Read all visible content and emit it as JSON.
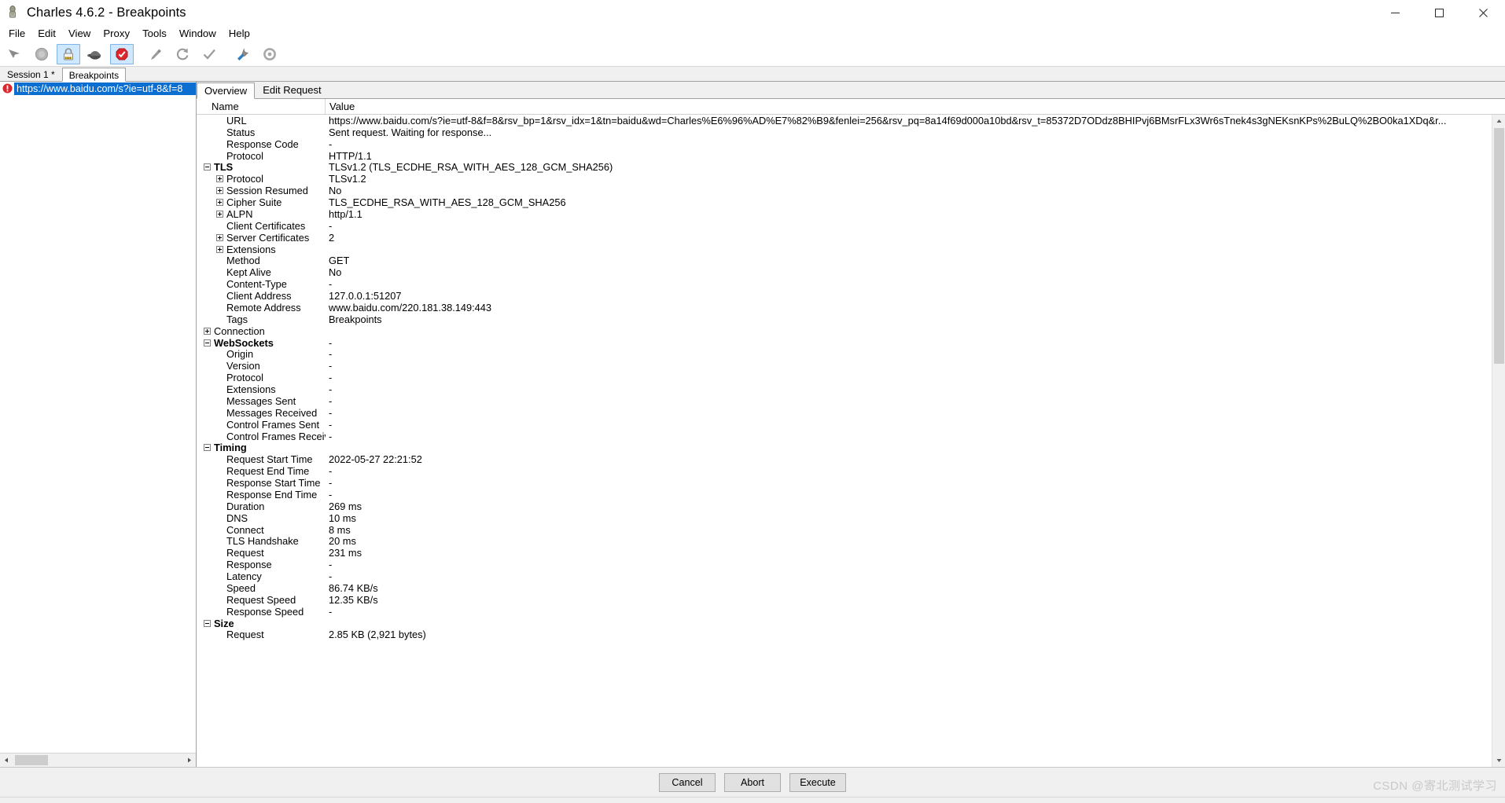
{
  "window": {
    "title": "Charles 4.6.2 - Breakpoints",
    "icon": "charles-app-icon",
    "minimize": "─",
    "maximize": "☐",
    "close": "✕"
  },
  "menubar": {
    "items": [
      "File",
      "Edit",
      "View",
      "Proxy",
      "Tools",
      "Window",
      "Help"
    ]
  },
  "toolbar": {
    "buttons": [
      {
        "name": "clear-session-icon",
        "glyph": "➤",
        "active": false
      },
      {
        "name": "record-icon",
        "glyph": "●",
        "active": false
      },
      {
        "name": "ssl-proxying-icon",
        "glyph": "🔒",
        "active": true
      },
      {
        "name": "throttling-icon",
        "glyph": "🐢",
        "active": true
      },
      {
        "name": "breakpoints-icon",
        "glyph": "⬣",
        "active": true
      },
      {
        "name": "compose-icon",
        "glyph": "✎",
        "active": false
      },
      {
        "name": "repeat-icon",
        "glyph": "↻",
        "active": false
      },
      {
        "name": "validate-icon",
        "glyph": "✓",
        "active": false
      },
      {
        "name": "tools-icon",
        "glyph": "⚒",
        "active": false
      },
      {
        "name": "settings-icon",
        "glyph": "⚙",
        "active": false
      }
    ]
  },
  "session_tabs": {
    "items": [
      {
        "label": "Session 1 *",
        "selected": false
      },
      {
        "label": "Breakpoints",
        "selected": true
      }
    ]
  },
  "request_list": {
    "items": [
      {
        "icon": "breakpoint-stop-icon",
        "url": "https://www.baidu.com/s?ie=utf-8&f=8",
        "selected": true
      }
    ]
  },
  "view_tabs": {
    "items": [
      {
        "label": "Overview",
        "selected": true
      },
      {
        "label": "Edit Request",
        "selected": false
      }
    ]
  },
  "table": {
    "headers": {
      "name": "Name",
      "value": "Value"
    },
    "rows": [
      {
        "indent": 1,
        "twisty": "none",
        "group": false,
        "name": "URL",
        "value": "https://www.baidu.com/s?ie=utf-8&f=8&rsv_bp=1&rsv_idx=1&tn=baidu&wd=Charles%E6%96%AD%E7%82%B9&fenlei=256&rsv_pq=8a14f69d000a10bd&rsv_t=85372D7ODdz8BHIPvj6BMsrFLx3Wr6sTnek4s3gNEKsnKPs%2BuLQ%2BO0ka1XDq&r..."
      },
      {
        "indent": 1,
        "twisty": "none",
        "group": false,
        "name": "Status",
        "value": "Sent request. Waiting for response..."
      },
      {
        "indent": 1,
        "twisty": "none",
        "group": false,
        "name": "Response Code",
        "value": "-"
      },
      {
        "indent": 1,
        "twisty": "none",
        "group": false,
        "name": "Protocol",
        "value": "HTTP/1.1"
      },
      {
        "indent": 0,
        "twisty": "minus",
        "group": true,
        "name": "TLS",
        "value": "TLSv1.2 (TLS_ECDHE_RSA_WITH_AES_128_GCM_SHA256)"
      },
      {
        "indent": 1,
        "twisty": "plus",
        "group": false,
        "name": "Protocol",
        "value": "TLSv1.2"
      },
      {
        "indent": 1,
        "twisty": "plus",
        "group": false,
        "name": "Session Resumed",
        "value": "No"
      },
      {
        "indent": 1,
        "twisty": "plus",
        "group": false,
        "name": "Cipher Suite",
        "value": "TLS_ECDHE_RSA_WITH_AES_128_GCM_SHA256"
      },
      {
        "indent": 1,
        "twisty": "plus",
        "group": false,
        "name": "ALPN",
        "value": "http/1.1"
      },
      {
        "indent": 1,
        "twisty": "none",
        "group": false,
        "name": "Client Certificates",
        "value": "-"
      },
      {
        "indent": 1,
        "twisty": "plus",
        "group": false,
        "name": "Server Certificates",
        "value": "2"
      },
      {
        "indent": 1,
        "twisty": "plus",
        "group": false,
        "name": "Extensions",
        "value": ""
      },
      {
        "indent": 1,
        "twisty": "none",
        "group": false,
        "name": "Method",
        "value": "GET"
      },
      {
        "indent": 1,
        "twisty": "none",
        "group": false,
        "name": "Kept Alive",
        "value": "No"
      },
      {
        "indent": 1,
        "twisty": "none",
        "group": false,
        "name": "Content-Type",
        "value": "-"
      },
      {
        "indent": 1,
        "twisty": "none",
        "group": false,
        "name": "Client Address",
        "value": "127.0.0.1:51207"
      },
      {
        "indent": 1,
        "twisty": "none",
        "group": false,
        "name": "Remote Address",
        "value": "www.baidu.com/220.181.38.149:443"
      },
      {
        "indent": 1,
        "twisty": "none",
        "group": false,
        "name": "Tags",
        "value": "Breakpoints"
      },
      {
        "indent": 0,
        "twisty": "plus",
        "group": false,
        "name": "Connection",
        "value": ""
      },
      {
        "indent": 0,
        "twisty": "minus",
        "group": true,
        "name": "WebSockets",
        "value": "-"
      },
      {
        "indent": 1,
        "twisty": "none",
        "group": false,
        "name": "Origin",
        "value": "-"
      },
      {
        "indent": 1,
        "twisty": "none",
        "group": false,
        "name": "Version",
        "value": "-"
      },
      {
        "indent": 1,
        "twisty": "none",
        "group": false,
        "name": "Protocol",
        "value": "-"
      },
      {
        "indent": 1,
        "twisty": "none",
        "group": false,
        "name": "Extensions",
        "value": "-"
      },
      {
        "indent": 1,
        "twisty": "none",
        "group": false,
        "name": "Messages Sent",
        "value": "-"
      },
      {
        "indent": 1,
        "twisty": "none",
        "group": false,
        "name": "Messages Received",
        "value": "-"
      },
      {
        "indent": 1,
        "twisty": "none",
        "group": false,
        "name": "Control Frames Sent",
        "value": "-"
      },
      {
        "indent": 1,
        "twisty": "none",
        "group": false,
        "name": "Control Frames Received",
        "value": "-"
      },
      {
        "indent": 0,
        "twisty": "minus",
        "group": true,
        "name": "Timing",
        "value": ""
      },
      {
        "indent": 1,
        "twisty": "none",
        "group": false,
        "name": "Request Start Time",
        "value": "2022-05-27 22:21:52"
      },
      {
        "indent": 1,
        "twisty": "none",
        "group": false,
        "name": "Request End Time",
        "value": "-"
      },
      {
        "indent": 1,
        "twisty": "none",
        "group": false,
        "name": "Response Start Time",
        "value": "-"
      },
      {
        "indent": 1,
        "twisty": "none",
        "group": false,
        "name": "Response End Time",
        "value": "-"
      },
      {
        "indent": 1,
        "twisty": "none",
        "group": false,
        "name": "Duration",
        "value": "269 ms"
      },
      {
        "indent": 1,
        "twisty": "none",
        "group": false,
        "name": "DNS",
        "value": "10 ms"
      },
      {
        "indent": 1,
        "twisty": "none",
        "group": false,
        "name": "Connect",
        "value": "8 ms"
      },
      {
        "indent": 1,
        "twisty": "none",
        "group": false,
        "name": "TLS Handshake",
        "value": "20 ms"
      },
      {
        "indent": 1,
        "twisty": "none",
        "group": false,
        "name": "Request",
        "value": "231 ms"
      },
      {
        "indent": 1,
        "twisty": "none",
        "group": false,
        "name": "Response",
        "value": "-"
      },
      {
        "indent": 1,
        "twisty": "none",
        "group": false,
        "name": "Latency",
        "value": "-"
      },
      {
        "indent": 1,
        "twisty": "none",
        "group": false,
        "name": "Speed",
        "value": "86.74 KB/s"
      },
      {
        "indent": 1,
        "twisty": "none",
        "group": false,
        "name": "Request Speed",
        "value": "12.35 KB/s"
      },
      {
        "indent": 1,
        "twisty": "none",
        "group": false,
        "name": "Response Speed",
        "value": "-"
      },
      {
        "indent": 0,
        "twisty": "minus",
        "group": true,
        "name": "Size",
        "value": ""
      },
      {
        "indent": 1,
        "twisty": "none",
        "group": false,
        "name": "Request",
        "value": "2.85 KB (2,921 bytes)"
      }
    ]
  },
  "actions": {
    "cancel": "Cancel",
    "abort": "Abort",
    "execute": "Execute"
  },
  "watermark": "CSDN @寄北测试学习",
  "colors": {
    "selection_blue": "#0a6fd1",
    "toolbar_active": "#cde8ff",
    "breakpoint_red": "#d8262c"
  }
}
